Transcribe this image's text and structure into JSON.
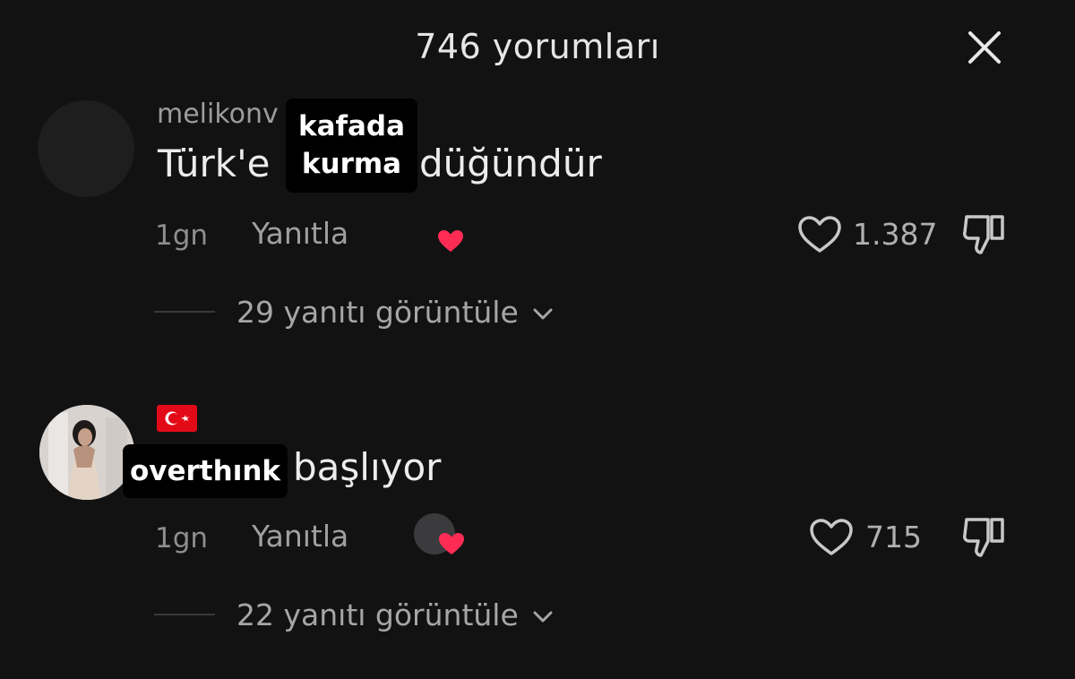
{
  "header": {
    "title": "746 yorumları"
  },
  "comments": [
    {
      "username": "melikonv",
      "text_before": "Türk'e",
      "text_after": "düğündür",
      "sticker": "kafada kurma",
      "time": "1gn",
      "reply_label": "Yanıtla",
      "likes": "1.387",
      "view_replies": "29 yanıtı görüntüle"
    },
    {
      "flag": "turkey-flag",
      "text_after": "başlıyor",
      "sticker": "overthınk",
      "time": "1gn",
      "reply_label": "Yanıtla",
      "likes": "715",
      "view_replies": "22 yanıtı görüntüle"
    }
  ],
  "colors": {
    "background": "#121213",
    "creator_heart": "#fe2c55",
    "sticker_bg": "#000000",
    "flag_red": "#e30a17"
  }
}
